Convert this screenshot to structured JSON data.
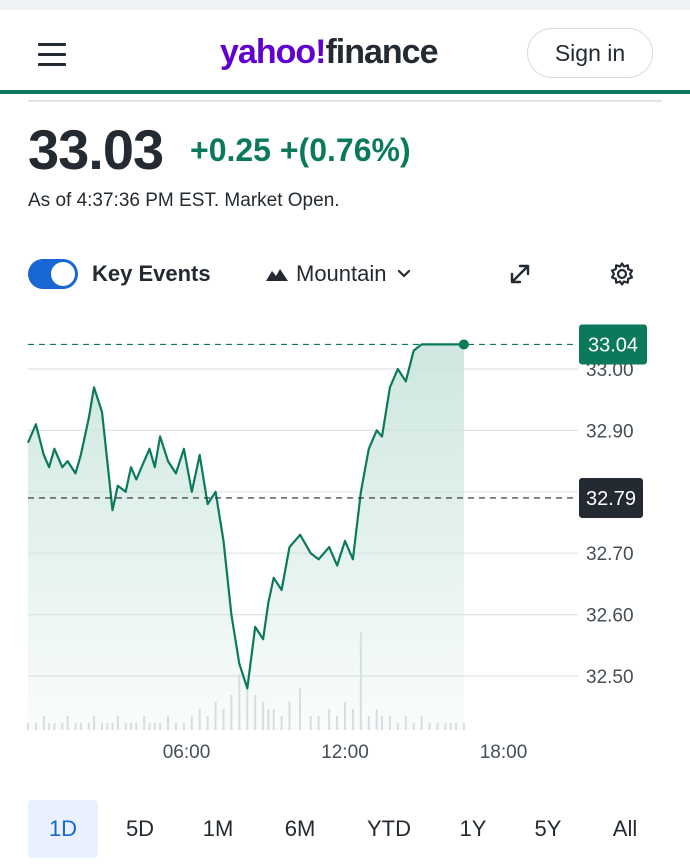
{
  "header": {
    "logo_part1": "yahoo!",
    "logo_part2": "finance",
    "signin_label": "Sign in"
  },
  "quote": {
    "price": "33.03",
    "change": "+0.25 +(0.76%)",
    "as_of": "As of 4:37:36 PM EST. Market Open."
  },
  "controls": {
    "key_events_label": "Key Events",
    "key_events_on": true,
    "chart_type_label": "Mountain"
  },
  "chart_data": {
    "type": "area",
    "x_ticks": [
      "06:00",
      "12:00",
      "18:00"
    ],
    "y_ticks": [
      "33.00",
      "32.90",
      "32.70",
      "32.60",
      "32.50"
    ],
    "current_price_label": "33.04",
    "prev_close_label": "32.79",
    "current_price": 33.04,
    "prev_close": 32.79,
    "ylim": [
      32.415,
      33.1
    ],
    "xlim": [
      0,
      24
    ],
    "grid": true,
    "series": [
      {
        "x": [
          0,
          0.3,
          0.6,
          0.8,
          1.0,
          1.3,
          1.5,
          1.8,
          2.0,
          2.3,
          2.5,
          2.8,
          3.0,
          3.2,
          3.4,
          3.7,
          3.9,
          4.1,
          4.4,
          4.6,
          4.8,
          5.0,
          5.3,
          5.6,
          5.9,
          6.2,
          6.5,
          6.8,
          7.1,
          7.4,
          7.7,
          8.0,
          8.3,
          8.6,
          8.9,
          9.1,
          9.3,
          9.6,
          9.9,
          10.3,
          10.7,
          11.0,
          11.4,
          11.7,
          12.0,
          12.3,
          12.6,
          12.9,
          13.2,
          13.4,
          13.7,
          14.0,
          14.3,
          14.6,
          14.9,
          15.2,
          15.5,
          15.8,
          16.0,
          16.2,
          16.5
        ],
        "values": [
          32.88,
          32.91,
          32.86,
          32.84,
          32.87,
          32.84,
          32.85,
          32.83,
          32.86,
          32.92,
          32.97,
          32.93,
          32.85,
          32.77,
          32.81,
          32.8,
          32.84,
          32.82,
          32.85,
          32.87,
          32.84,
          32.89,
          32.85,
          32.83,
          32.87,
          32.8,
          32.86,
          32.78,
          32.8,
          32.72,
          32.6,
          32.52,
          32.48,
          32.58,
          32.56,
          32.62,
          32.66,
          32.64,
          32.71,
          32.73,
          32.7,
          32.69,
          32.71,
          32.68,
          32.72,
          32.69,
          32.8,
          32.87,
          32.9,
          32.89,
          32.97,
          33.0,
          32.98,
          33.03,
          33.04,
          33.04,
          33.04,
          33.04,
          33.04,
          33.04,
          33.04
        ],
        "volume": [
          1,
          1,
          2,
          1,
          1,
          1,
          2,
          1,
          1,
          1,
          2,
          1,
          1,
          1,
          2,
          1,
          1,
          1,
          2,
          1,
          1,
          1,
          2,
          1,
          1,
          2,
          3,
          2,
          4,
          3,
          5,
          8,
          6,
          5,
          4,
          3,
          3,
          2,
          4,
          6,
          2,
          2,
          3,
          2,
          4,
          3,
          14,
          2,
          3,
          2,
          2,
          1,
          2,
          1,
          2,
          1,
          1,
          1,
          1,
          1,
          1
        ]
      }
    ],
    "colors": {
      "line": "#0b7a5c",
      "area_top": "#c9e4dc",
      "current_badge": "#0b7a5c",
      "prev_close_badge": "#232a31",
      "grid": "#dfe3e8",
      "volume": "#d8dde3"
    }
  },
  "ranges": [
    "1D",
    "5D",
    "1M",
    "6M",
    "YTD",
    "1Y",
    "5Y",
    "All"
  ],
  "active_range": "1D"
}
